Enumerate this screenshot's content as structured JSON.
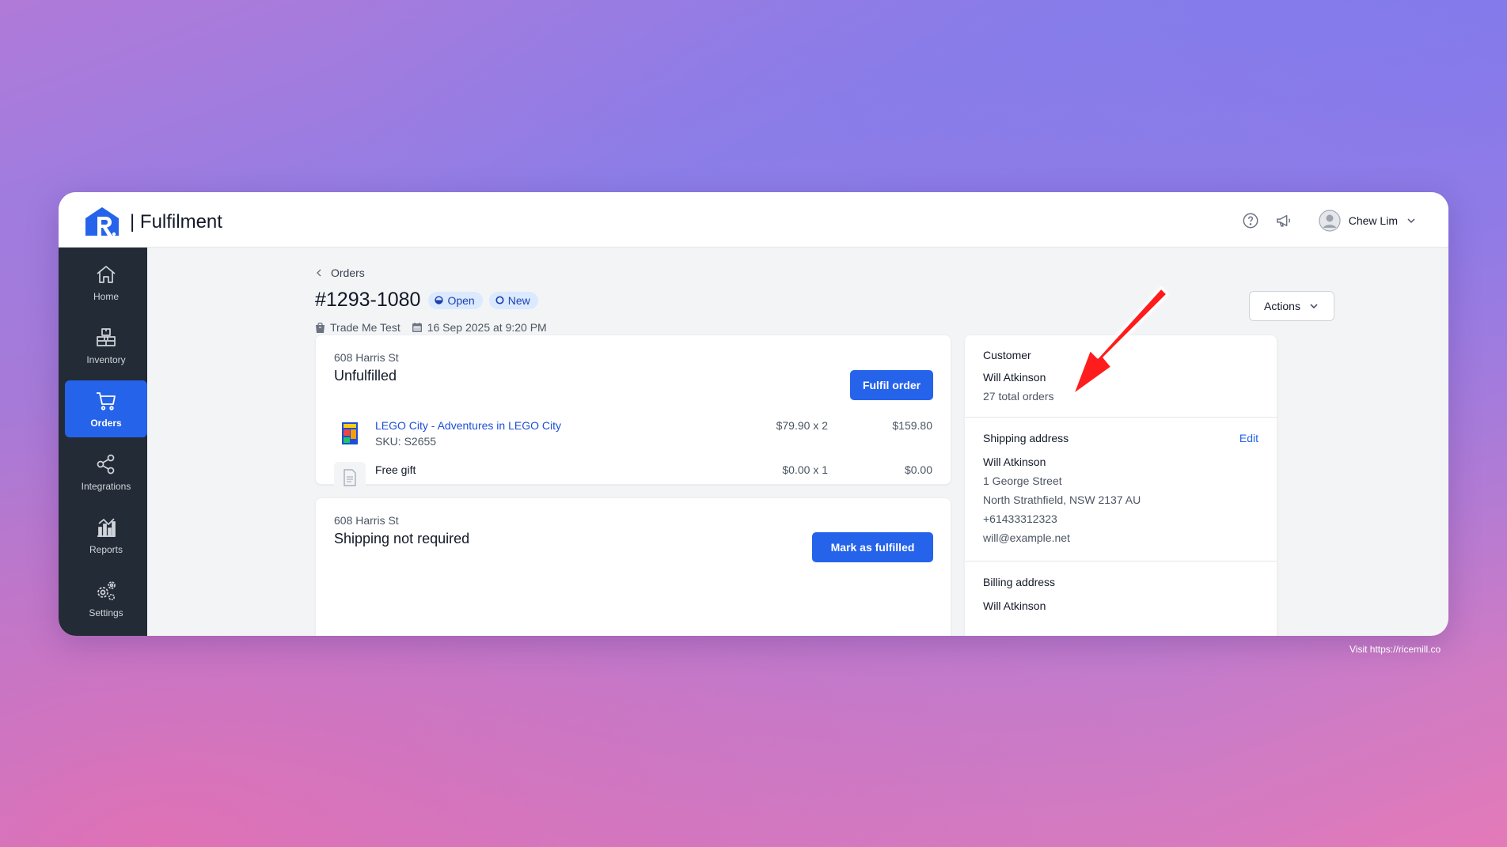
{
  "app": {
    "brand": "| Fulfilment"
  },
  "header": {
    "user_name": "Chew Lim"
  },
  "sidebar": {
    "items": [
      {
        "label": "Home",
        "icon": "home-icon"
      },
      {
        "label": "Inventory",
        "icon": "inventory-icon"
      },
      {
        "label": "Orders",
        "icon": "cart-icon"
      },
      {
        "label": "Integrations",
        "icon": "share-icon"
      },
      {
        "label": "Reports",
        "icon": "chart-icon"
      },
      {
        "label": "Settings",
        "icon": "gears-icon"
      }
    ],
    "active": "Orders"
  },
  "breadcrumb": {
    "label": "Orders"
  },
  "order": {
    "title": "#1293-1080",
    "badges": [
      "Open",
      "New"
    ],
    "store": "Trade Me Test",
    "date": "16 Sep 2025 at 9:20 PM"
  },
  "actions": {
    "label": "Actions"
  },
  "fulfilment_groups": [
    {
      "location": "608 Harris St",
      "status": "Unfulfilled",
      "button": "Fulfil order",
      "items": [
        {
          "name": "LEGO City - Adventures in LEGO City",
          "sku": "SKU: S2655",
          "qty": "$79.90 x 2",
          "total": "$159.80"
        },
        {
          "name": "Free gift",
          "sku": "",
          "qty": "$0.00 x 1",
          "total": "$0.00"
        }
      ]
    },
    {
      "location": "608 Harris St",
      "status": "Shipping not required",
      "button": "Mark as fulfilled"
    }
  ],
  "customer": {
    "title": "Customer",
    "name": "Will Atkinson",
    "orders": "27 total orders"
  },
  "shipping": {
    "title": "Shipping address",
    "edit": "Edit",
    "name": "Will Atkinson",
    "street": "1 George Street",
    "city": "North Strathfield, NSW 2137 AU",
    "phone": "+61433312323",
    "email": "will@example.net"
  },
  "billing": {
    "title": "Billing address",
    "name": "Will Atkinson"
  },
  "footer": {
    "note": "Visit https://ricemill.co"
  },
  "colors": {
    "primary": "#2563eb",
    "sidebar": "#232b36",
    "badge_bg": "#dbeafe",
    "arrow": "#ff1a1a"
  }
}
